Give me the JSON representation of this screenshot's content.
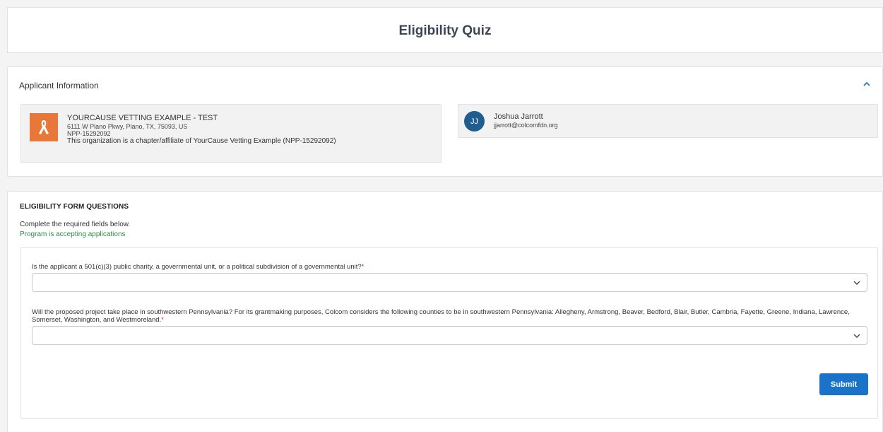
{
  "page": {
    "title": "Eligibility Quiz"
  },
  "applicant": {
    "section_label": "Applicant Information",
    "org": {
      "name": "YOURCAUSE VETTING EXAMPLE - TEST",
      "address": "6111 W Plano Pkwy, Plano, TX, 75093, US",
      "npp_id": "NPP-15292092",
      "affiliation_note": "This organization is a chapter/affiliate of YourCause Vetting Example (NPP-15292092)",
      "logo_color": "#e8773a"
    },
    "user": {
      "initials": "JJ",
      "name": "Joshua Jarrott",
      "email": "jjarrott@colcomfdn.org",
      "avatar_color": "#1e5d8e"
    }
  },
  "form": {
    "heading": "ELIGIBILITY FORM QUESTIONS",
    "instructions": "Complete the required fields below.",
    "status": "Program is accepting applications",
    "questions": [
      {
        "label": "Is the applicant a 501(c)(3) public charity, a governmental unit, or a political subdivision of a governmental unit?",
        "required_mark": "*",
        "value": ""
      },
      {
        "label": "Will the proposed project take place in southwestern Pennsylvania? For its grantmaking purposes, Colcom considers the following counties to be in southwestern Pennsylvania: Allegheny, Armstrong, Beaver, Bedford, Blair, Butler, Cambria, Fayette, Greene, Indiana, Lawrence, Somerset, Washington, and Westmoreland.",
        "required_mark": "*",
        "value": ""
      }
    ],
    "submit_label": "Submit"
  },
  "colors": {
    "accent": "#1a73c9",
    "status_green": "#2e8a4a",
    "required_red": "#d0312d"
  }
}
